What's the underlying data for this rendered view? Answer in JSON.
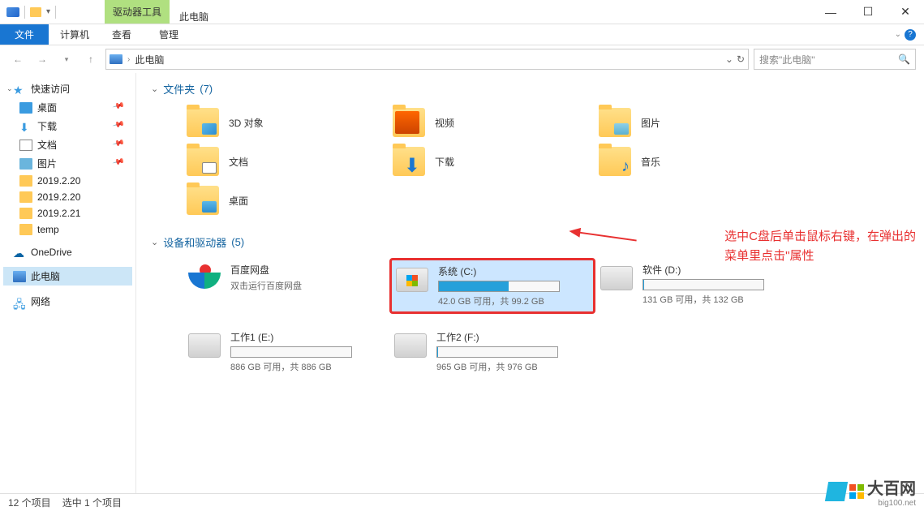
{
  "title": "此电脑",
  "ribbon_context_top": "驱动器工具",
  "ribbon_context_sub": "管理",
  "ribbon": {
    "file": "文件",
    "computer": "计算机",
    "view": "查看"
  },
  "address": {
    "location": "此电脑",
    "search_placeholder": "搜索\"此电脑\""
  },
  "sidebar": {
    "quick": "快速访问",
    "desktop": "桌面",
    "downloads": "下载",
    "documents": "文档",
    "pictures": "图片",
    "f1": "2019.2.20",
    "f2": "2019.2.20",
    "f3": "2019.2.21",
    "f4": "temp",
    "onedrive": "OneDrive",
    "thispc": "此电脑",
    "network": "网络"
  },
  "sections": {
    "folders_label": "文件夹",
    "folders_count": "(7)",
    "devices_label": "设备和驱动器",
    "devices_count": "(5)"
  },
  "folders": {
    "objects3d": "3D 对象",
    "videos": "视频",
    "pictures": "图片",
    "documents": "文档",
    "downloads": "下载",
    "music": "音乐",
    "desktop": "桌面"
  },
  "drives": {
    "baidu": {
      "label": "百度网盘",
      "sub": "双击运行百度网盘"
    },
    "c": {
      "label": "系统 (C:)",
      "sub": "42.0 GB 可用，共 99.2 GB",
      "used_pct": 58
    },
    "d": {
      "label": "软件 (D:)",
      "sub": "131 GB 可用，共 132 GB",
      "used_pct": 1
    },
    "e": {
      "label": "工作1 (E:)",
      "sub": "886 GB 可用，共 886 GB",
      "used_pct": 0
    },
    "f": {
      "label": "工作2 (F:)",
      "sub": "965 GB 可用，共 976 GB",
      "used_pct": 1
    }
  },
  "annotation": {
    "line1": "选中C盘后单击鼠标右键，在弹出的",
    "line2": "菜单里点击\"属性"
  },
  "status": {
    "items": "12 个项目",
    "selected": "选中 1 个项目"
  },
  "watermark": {
    "brand": "大百网",
    "sub": "big100.net"
  }
}
